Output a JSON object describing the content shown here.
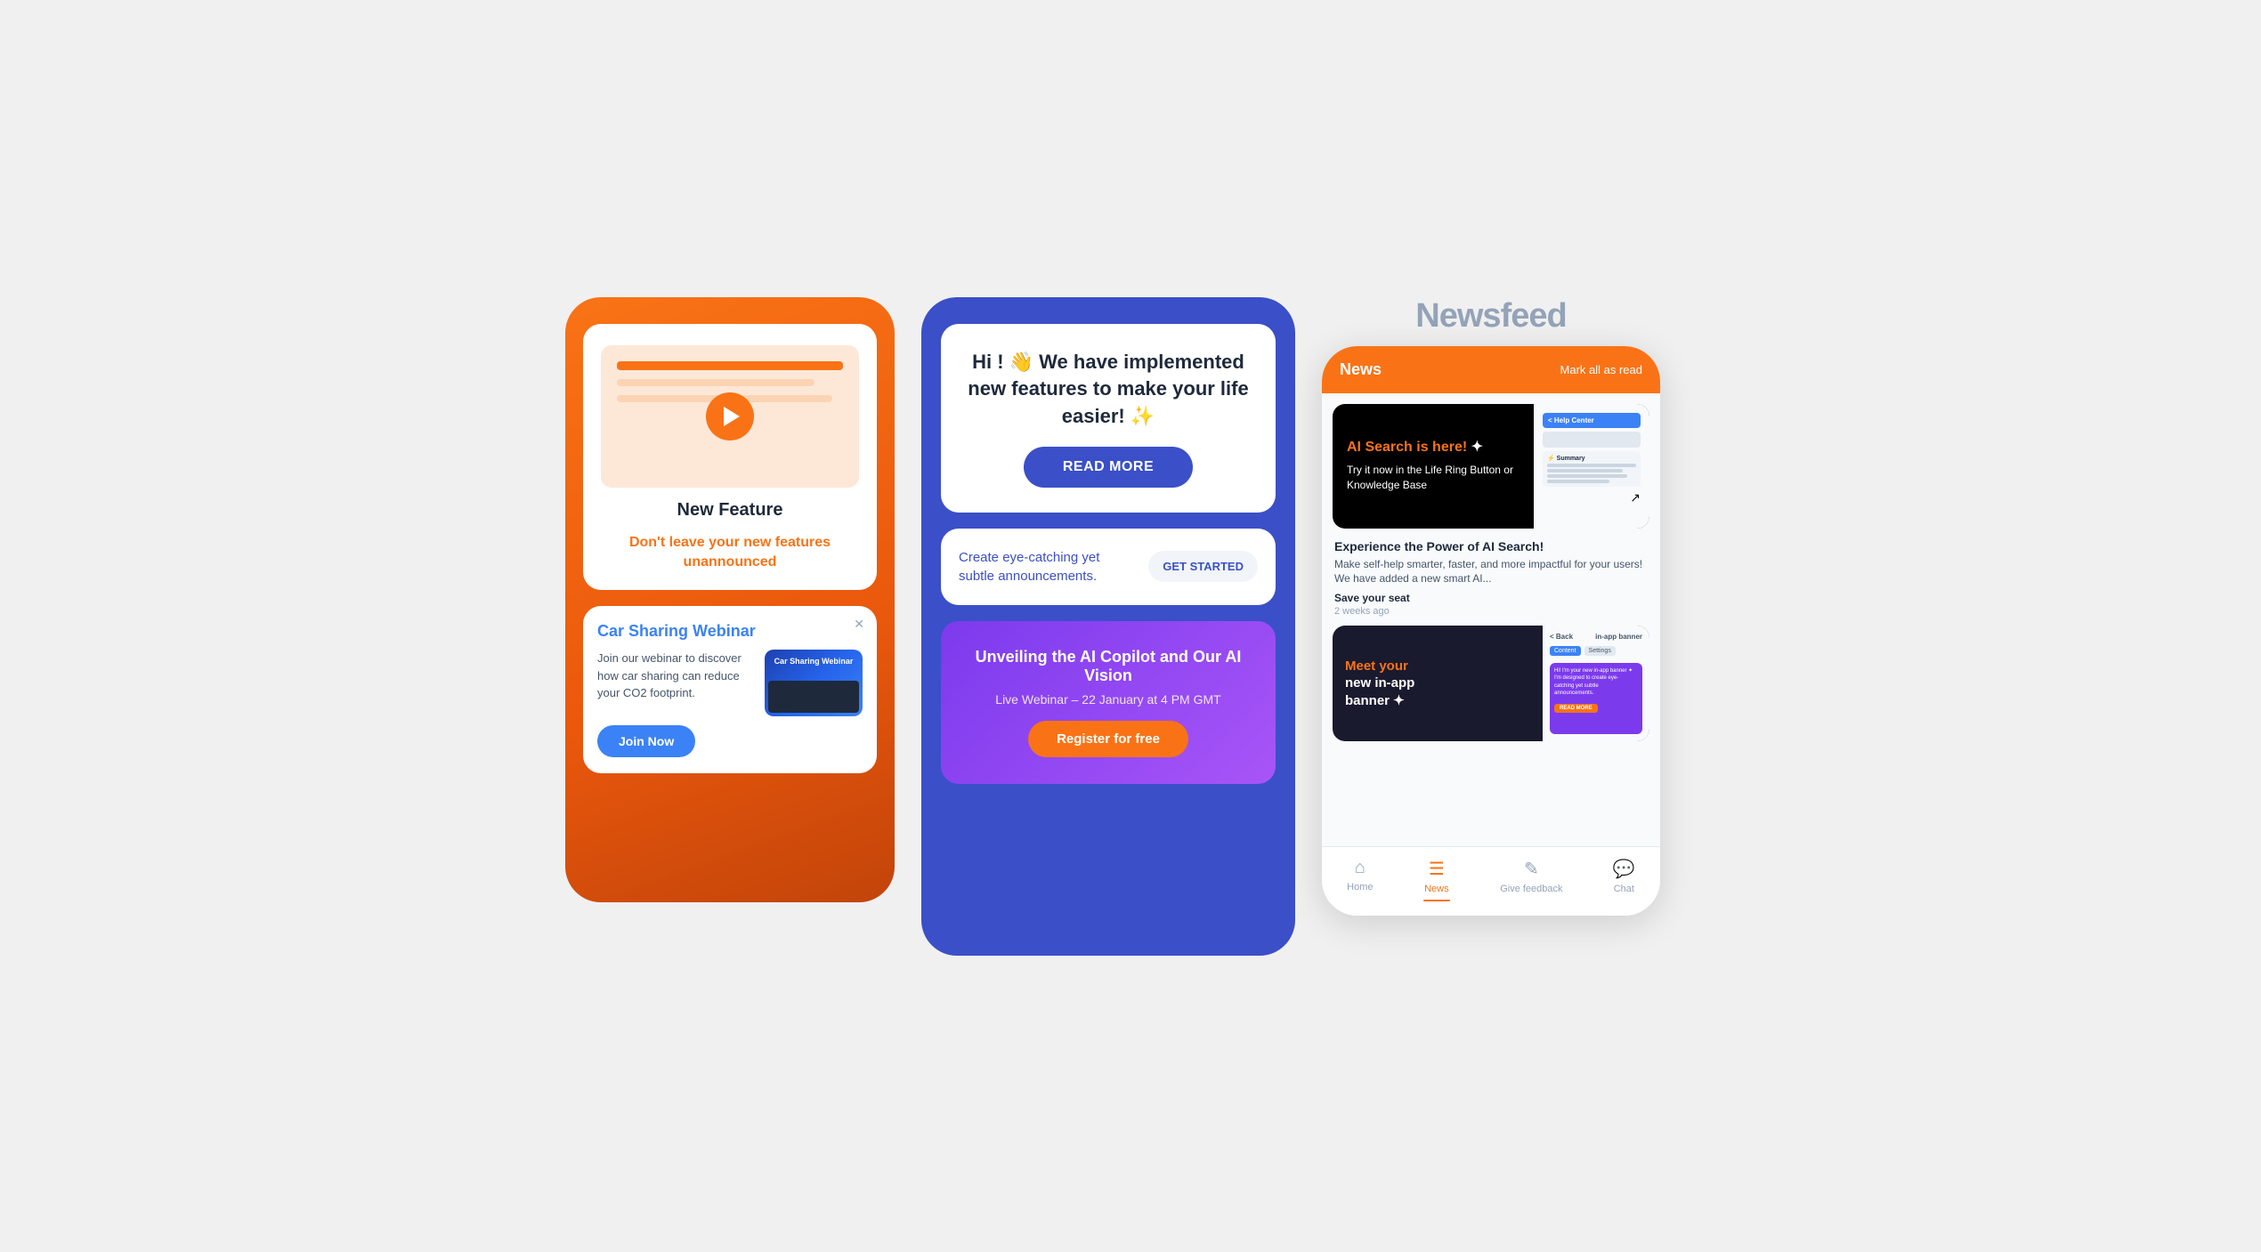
{
  "phone1": {
    "feature_card": {
      "title": "New Feature",
      "subtitle": "Don't leave your new features unannounced"
    },
    "webinar_card": {
      "title": "Car Sharing Webinar",
      "text": "Join our webinar to discover how car sharing can reduce your CO2 footprint.",
      "img_label": "Car Sharing Webinar",
      "join_label": "Join Now"
    }
  },
  "phone2": {
    "announce": {
      "text": "Hi ! 👋 We have implemented new features to make your life easier! ✨",
      "read_more": "READ MORE"
    },
    "subtle": {
      "text": "Create eye-catching yet subtle announcements.",
      "cta": "GET STARTED"
    },
    "webinar": {
      "title": "Unveiling the AI Copilot and Our AI Vision",
      "subtitle": "Live Webinar – 22 January at 4 PM GMT",
      "register": "Register for free"
    }
  },
  "phone3": {
    "newsfeed_title": "Newsfeed",
    "header": {
      "title": "News",
      "mark_read": "Mark all as read"
    },
    "card1": {
      "ai_title": "AI Search is here!",
      "ai_sparkle": "✦",
      "ai_sub": "Try it now in the Life Ring Button or Knowledge Base",
      "help_center": "< Help Center",
      "summary_title": "⚡ Summary",
      "desc_title": "Experience the Power of AI Search!",
      "desc_text": "Make self-help smarter, faster, and more impactful for your users! We have added a new smart AI...",
      "save": "Save your seat",
      "time": "2 weeks ago"
    },
    "card2": {
      "meet": "Meet your",
      "new_inapp": "new in-app",
      "banner": "banner ✦",
      "back": "< Back",
      "in_app_banner": "in-app banner",
      "content_tab": "Content",
      "settings_tab": "Settings",
      "preview_text": "Hi! I'm your new in-app banner ✦ I'm designed to create eye-catching yet subtle announcements.",
      "readmore": "READ MORE"
    },
    "nav": {
      "home": "Home",
      "news": "News",
      "feedback": "Give feedback",
      "chat": "Chat"
    }
  }
}
